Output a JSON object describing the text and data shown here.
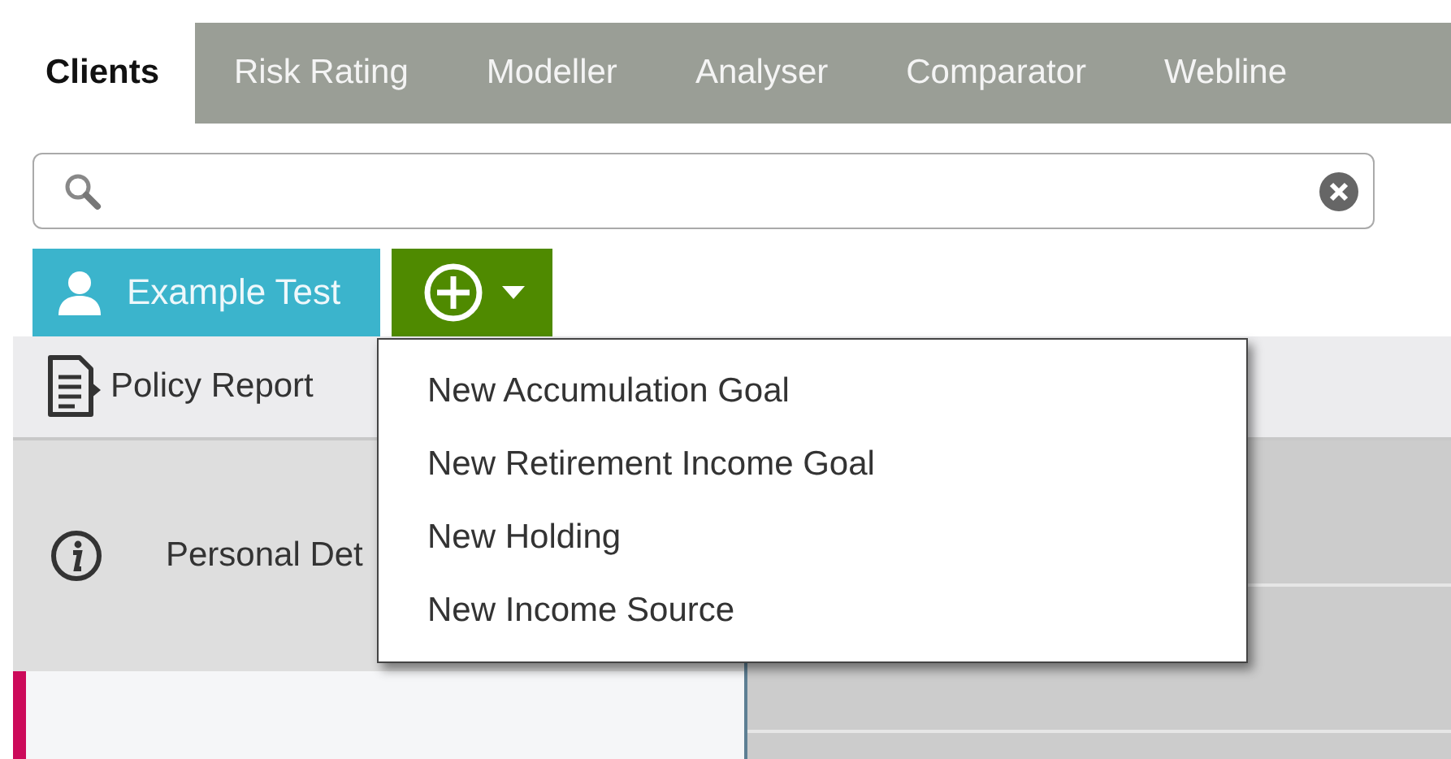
{
  "tabs": [
    {
      "label": "Clients",
      "selected": true
    },
    {
      "label": "Risk Rating",
      "selected": false
    },
    {
      "label": "Modeller",
      "selected": false
    },
    {
      "label": "Analyser",
      "selected": false
    },
    {
      "label": "Comparator",
      "selected": false
    },
    {
      "label": "Webline",
      "selected": false
    }
  ],
  "client_button": {
    "label": "Example Test"
  },
  "add_menu": {
    "expanded": true,
    "items": [
      "New Accumulation Goal",
      "New Retirement Income Goal",
      "New Holding",
      "New Income Source"
    ]
  },
  "toolbar": {
    "items": [
      {
        "label": "Policy Report"
      }
    ]
  },
  "sidebar": {
    "items": [
      {
        "label": "Personal Det",
        "selected": false
      },
      {
        "selected": true
      }
    ]
  }
}
